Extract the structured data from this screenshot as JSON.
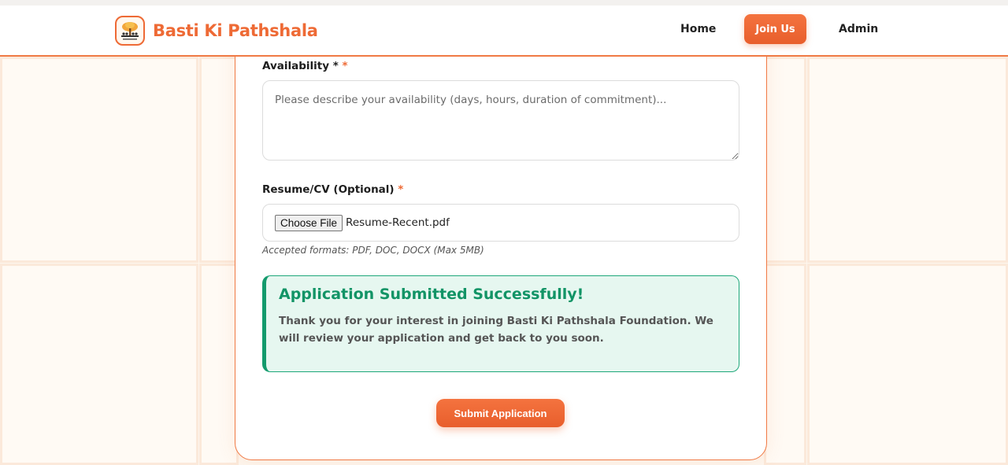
{
  "header": {
    "brand": "Basti Ki Pathshala",
    "nav": {
      "home": "Home",
      "join": "Join Us",
      "admin": "Admin"
    }
  },
  "form": {
    "availability": {
      "label": "Availability *",
      "required_mark": "*",
      "placeholder": "Please describe your availability (days, hours, duration of commitment)..."
    },
    "resume": {
      "label": "Resume/CV (Optional)",
      "required_mark": "*",
      "button_label": "Choose File",
      "file_name": "Resume-Recent.pdf",
      "hint": "Accepted formats: PDF, DOC, DOCX (Max 5MB)"
    },
    "success": {
      "title": "Application Submitted Successfully!",
      "message": "Thank you for your interest in joining Basti Ki Pathshala Foundation. We will review your application and get back to you soon."
    },
    "submit_label": "Submit Application"
  },
  "colors": {
    "accent": "#ee6a35",
    "success": "#129466",
    "success_bg": "#e6f7f0"
  }
}
